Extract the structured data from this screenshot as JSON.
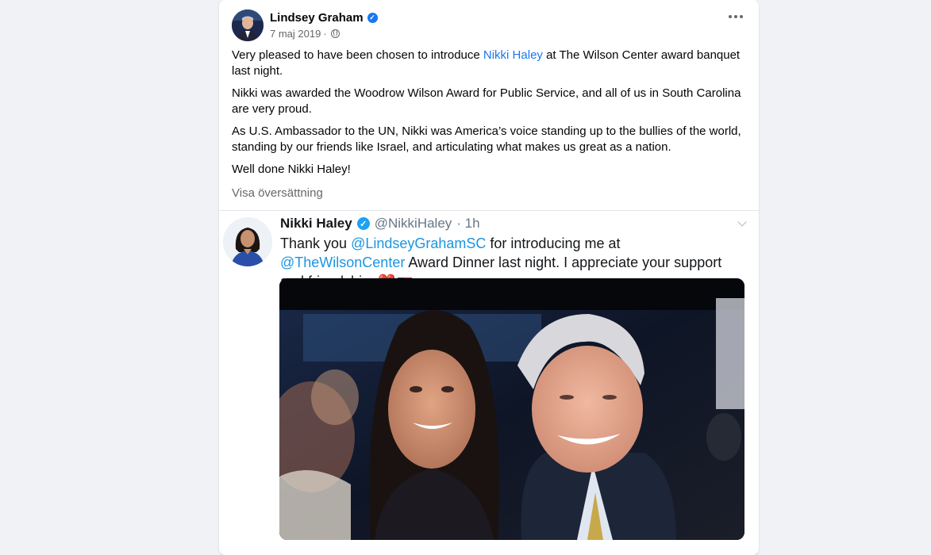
{
  "post": {
    "author": "Lindsey Graham",
    "date": "7 maj 2019",
    "separator": "·",
    "paragraph1_pre": "Very pleased to have been chosen to introduce ",
    "paragraph1_link": "Nikki Haley",
    "paragraph1_post": " at The Wilson Center award banquet last night.",
    "paragraph2": "Nikki was awarded the Woodrow Wilson Award for Public Service, and all of us in South Carolina are very proud.",
    "paragraph3": "As U.S. Ambassador to the UN, Nikki was America’s voice standing up to the bullies of the world, standing by our friends like Israel, and articulating what makes us great as a nation.",
    "paragraph4": "Well done Nikki Haley!",
    "translate_label": "Visa översättning"
  },
  "tweet": {
    "name": "Nikki Haley",
    "handle": "@NikkiHaley",
    "time": "· 1h",
    "text_pre": "Thank you ",
    "mention1": "@LindseyGrahamSC",
    "text_mid": " for introducing me at ",
    "mention2": "@TheWilsonCenter",
    "text_post": " Award Dinner last night. I appreciate your support and friendship. ",
    "heart": "❤️"
  },
  "icons": {
    "verified": "verified-badge-icon",
    "globe": "globe-icon",
    "more": "more-options-icon",
    "chevron": "chevron-down-icon",
    "flag": "us-flag-icon"
  },
  "colors": {
    "link": "#1877f2",
    "twitter_link": "#1b95e0",
    "secondary_text": "#65676b"
  }
}
